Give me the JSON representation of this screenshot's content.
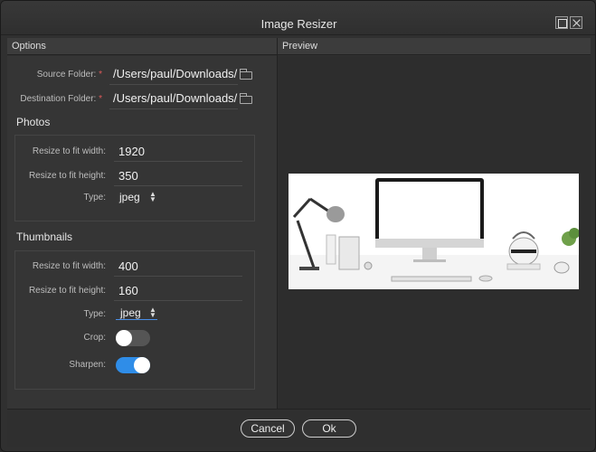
{
  "window": {
    "title": "Image Resizer"
  },
  "panels": {
    "options_title": "Options",
    "preview_title": "Preview"
  },
  "folders": {
    "source_label": "Source Folder:",
    "source_value": "/Users/paul/Downloads/",
    "destination_label": "Destination Folder:",
    "destination_value": "/Users/paul/Downloads/",
    "required_mark": "*"
  },
  "photos": {
    "title": "Photos",
    "width_label": "Resize to fit width:",
    "width_value": "1920",
    "height_label": "Resize to fit height:",
    "height_value": "350",
    "type_label": "Type:",
    "type_value": "jpeg"
  },
  "thumbnails": {
    "title": "Thumbnails",
    "width_label": "Resize to fit width:",
    "width_value": "400",
    "height_label": "Resize to fit height:",
    "height_value": "160",
    "type_label": "Type:",
    "type_value": "jpeg",
    "crop_label": "Crop:",
    "crop_on": false,
    "sharpen_label": "Sharpen:",
    "sharpen_on": true
  },
  "buttons": {
    "cancel": "Cancel",
    "ok": "Ok"
  },
  "colors": {
    "accent": "#2f8de8",
    "required": "#e05a5a"
  }
}
